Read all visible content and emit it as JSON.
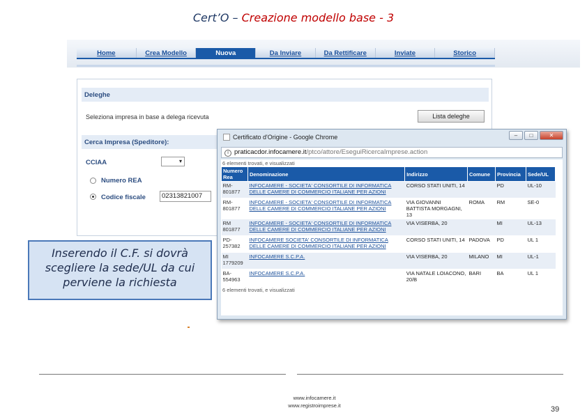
{
  "slide": {
    "title_part1": "Cert’O –",
    "title_part2": "Creazione modello base - 3",
    "callout_text": "Inserendo il C.F. si dovrà scegliere la sede/UL da cui perviene la richiesta",
    "footer_url1": "www.infocamere.it",
    "footer_url2": "www.registroimprese.it",
    "page_number": "39"
  },
  "app": {
    "nav": [
      {
        "label": "Home",
        "active": false
      },
      {
        "label": "Crea Modello",
        "active": false
      },
      {
        "label": "Nuova",
        "active": true
      },
      {
        "label": "Da Inviare",
        "active": false
      },
      {
        "label": "Da Rettificare",
        "active": false
      },
      {
        "label": "Inviate",
        "active": false
      },
      {
        "label": "Storico",
        "active": false
      }
    ],
    "deleghe_header": "Deleghe",
    "deleghe_text": "Seleziona impresa in base a delega ricevuta",
    "deleghe_button": "Lista deleghe",
    "cerca_header": "Cerca Impresa (Speditore):",
    "cciaa_label": "CCIAA",
    "cciaa_select_glyph": "▾",
    "numero_rea_label": "Numero REA",
    "codice_fiscale_label": "Codice fiscale",
    "codice_fiscale_value": "02313821007"
  },
  "popup": {
    "window_title": "Certificato d'Origine - Google Chrome",
    "btn_min": "–",
    "btn_max": "□",
    "btn_close": "✕",
    "info_glyph": "i",
    "url_domain": "praticacdor.infocamere.it",
    "url_path": "/ptco/attore/EseguiRicercaImprese.action",
    "count_top": "6 elementi trovati, e visualizzati",
    "count_bottom": "6 elementi trovati, e visualizzati",
    "columns": [
      "Numero Rea",
      "Denominazione",
      "Indirizzo",
      "Comune",
      "Provincia",
      "Sede/UL"
    ],
    "rows": [
      {
        "rea": "RM-801877",
        "denominazione": "INFOCAMERE - SOCIETA' CONSORTILE DI INFORMATICA DELLE CAMERE DI COMMERCIO ITALIANE PER AZIONI",
        "indirizzo": "CORSO STATI UNITI, 14",
        "comune": "",
        "provincia": "PD",
        "sede": "UL-10"
      },
      {
        "rea": "RM-801877",
        "denominazione": "INFOCAMERE - SOCIETA' CONSORTILE DI INFORMATICA DELLE CAMERE DI COMMERCIO ITALIANE PER AZIONI",
        "indirizzo": "VIA GIOVANNI BATTISTA MORGAGNI, 13",
        "comune": "ROMA",
        "provincia": "RM",
        "sede": "SE-0"
      },
      {
        "rea": "RM 801877",
        "denominazione": "INFOCAMERE - SOCIETA' CONSORTILE DI INFORMATICA DELLE CAMERE DI COMMERCIO ITALIANE PER AZIONI",
        "indirizzo": "VIA VISERBA, 20",
        "comune": "",
        "provincia": "MI",
        "sede": "UL-13"
      },
      {
        "rea": "PD-257382",
        "denominazione": "INFOCAMERE SOCIETA' CONSORTILE DI INFORMATICA DELLE CAMERE DI COMMERCIO ITALIANE PER AZIONI",
        "indirizzo": "CORSO STATI UNITI, 14",
        "comune": "PADOVA",
        "provincia": "PD",
        "sede": "UL 1"
      },
      {
        "rea": "MI 1779209",
        "denominazione": "INFOCAMERE S.C.P.A.",
        "indirizzo": "VIA VISERBA, 20",
        "comune": "MILANO",
        "provincia": "MI",
        "sede": "UL-1"
      },
      {
        "rea": "BA-554963",
        "denominazione": "INFOCAMERE S.C.P.A.",
        "indirizzo": "VIA NATALE LOIACONO, 20/B",
        "comune": "BARI",
        "provincia": "BA",
        "sede": "UL 1"
      }
    ]
  }
}
